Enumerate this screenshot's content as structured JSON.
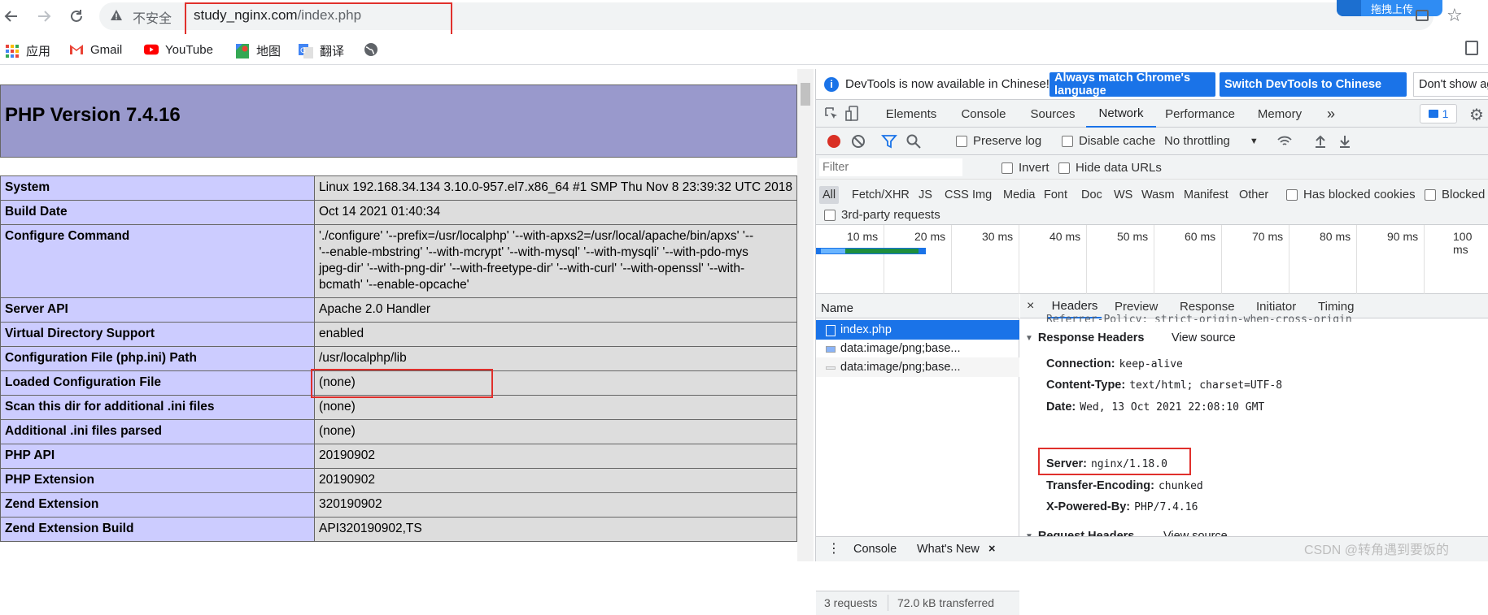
{
  "browser": {
    "insecure_label": "不安全",
    "url_host": "study_nginx.com",
    "url_path": "/index.php",
    "upload_label": "拖拽上传"
  },
  "bookmarks": [
    {
      "label": "应用",
      "icon": "apps-grid-icon"
    },
    {
      "label": "Gmail",
      "icon": "gmail-icon"
    },
    {
      "label": "YouTube",
      "icon": "youtube-icon"
    },
    {
      "label": "地图",
      "icon": "maps-icon"
    },
    {
      "label": "翻译",
      "icon": "translate-icon"
    },
    {
      "label": "",
      "icon": "globe-icon"
    }
  ],
  "php": {
    "title": "PHP Version 7.4.16",
    "rows": [
      {
        "key": "System",
        "value": "Linux 192.168.34.134 3.10.0-957.el7.x86_64 #1 SMP Thu Nov 8 23:39:32 UTC 2018"
      },
      {
        "key": "Build Date",
        "value": "Oct 14 2021 01:40:34"
      },
      {
        "key": "Configure Command",
        "value": "'./configure' '--prefix=/usr/localphp' '--with-apxs2=/usr/local/apache/bin/apxs' '--",
        "value2": "'--enable-mbstring' '--with-mcrypt' '--with-mysql' '--with-mysqli' '--with-pdo-mys",
        "value3": "jpeg-dir' '--with-png-dir' '--with-freetype-dir' '--with-curl' '--with-openssl' '--with-",
        "value4": "bcmath' '--enable-opcache'"
      },
      {
        "key": "Server API",
        "value": "Apache 2.0 Handler"
      },
      {
        "key": "Virtual Directory Support",
        "value": "enabled"
      },
      {
        "key": "Configuration File (php.ini) Path",
        "value": "/usr/localphp/lib"
      },
      {
        "key": "Loaded Configuration File",
        "value": "(none)"
      },
      {
        "key": "Scan this dir for additional .ini files",
        "value": "(none)"
      },
      {
        "key": "Additional .ini files parsed",
        "value": "(none)"
      },
      {
        "key": "PHP API",
        "value": "20190902"
      },
      {
        "key": "PHP Extension",
        "value": "20190902"
      },
      {
        "key": "Zend Extension",
        "value": "320190902"
      },
      {
        "key": "Zend Extension Build",
        "value": "API320190902,TS"
      }
    ]
  },
  "devtools": {
    "info_text": "DevTools is now available in Chinese!",
    "btn_match": "Always match Chrome's language",
    "btn_switch": "Switch DevTools to Chinese",
    "btn_dontshow": "Don't show again",
    "tabs": [
      "Elements",
      "Console",
      "Sources",
      "Network",
      "Performance",
      "Memory"
    ],
    "more_tabs": "»",
    "issues_count": "1",
    "preserve_log": "Preserve log",
    "disable_cache": "Disable cache",
    "throttling": "No throttling",
    "filter_placeholder": "Filter",
    "invert": "Invert",
    "hide_data_urls": "Hide data URLs",
    "types": [
      "All",
      "Fetch/XHR",
      "JS",
      "CSS",
      "Img",
      "Media",
      "Font",
      "Doc",
      "WS",
      "Wasm",
      "Manifest",
      "Other"
    ],
    "has_blocked_cookies": "Has blocked cookies",
    "blocked_requests": "Blocked Requests",
    "third_party": "3rd-party requests",
    "ticks": [
      "10 ms",
      "20 ms",
      "30 ms",
      "40 ms",
      "50 ms",
      "60 ms",
      "70 ms",
      "80 ms",
      "90 ms",
      "100 ms"
    ],
    "name_header": "Name",
    "requests": [
      "index.php",
      "data:image/png;base...",
      "data:image/png;base..."
    ],
    "status_requests": "3 requests",
    "status_transferred": "72.0 kB transferred",
    "detail_tabs": [
      "Headers",
      "Preview",
      "Response",
      "Initiator",
      "Timing"
    ],
    "close_label": "×",
    "referrer_partial": "Referrer-Policy: strict-origin-when-cross-origin",
    "response_headers_label": "Response Headers",
    "view_source": "View source",
    "headers": [
      {
        "k": "Connection:",
        "v": "keep-alive"
      },
      {
        "k": "Content-Type:",
        "v": "text/html; charset=UTF-8"
      },
      {
        "k": "Date:",
        "v": "Wed, 13 Oct 2021 22:08:10 GMT"
      },
      {
        "k": "Server:",
        "v": "nginx/1.18.0"
      },
      {
        "k": "Transfer-Encoding:",
        "v": "chunked"
      },
      {
        "k": "X-Powered-By:",
        "v": "PHP/7.4.16"
      }
    ],
    "request_headers_label": "Request Headers",
    "drawer_console": "Console",
    "drawer_whatsnew": "What's New",
    "drawer_close": "×"
  },
  "watermark": "CSDN @转角遇到要饭的"
}
